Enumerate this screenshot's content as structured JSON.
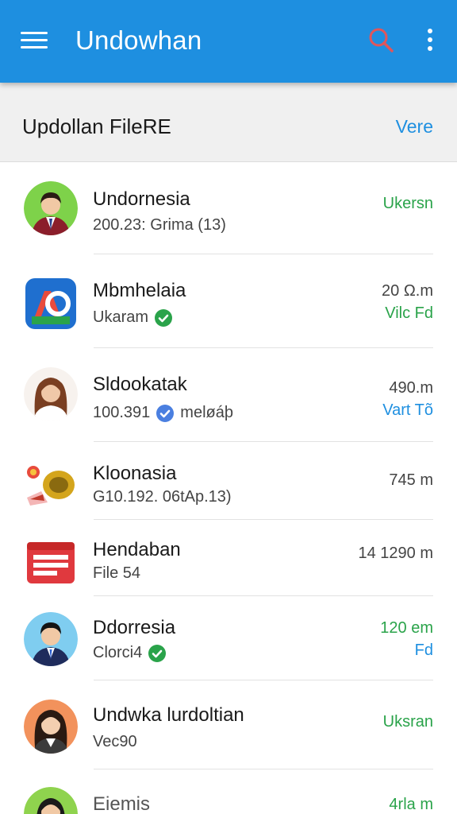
{
  "app": {
    "title": "Undowhan"
  },
  "header": {
    "title": "Updollan FileRE",
    "action": "Vere"
  },
  "items": [
    {
      "title": "Undornesia",
      "subtitle": "200.23:  Grima (13)",
      "meta": [
        "Ukersn"
      ],
      "meta_colors": [
        "green"
      ],
      "verified": false
    },
    {
      "title": "Mbmhelaia",
      "subtitle": "Ukaram",
      "meta": [
        "20 Ω.m",
        "Vilc Fd"
      ],
      "meta_colors": [
        "gray",
        "green"
      ],
      "verified": true
    },
    {
      "title": "Sldookatak",
      "subtitle": "100.391",
      "subtitle_after": "meløáþ",
      "meta": [
        "490.m",
        "Vart Tõ"
      ],
      "meta_colors": [
        "gray",
        "blue"
      ],
      "verified": true
    },
    {
      "title": "Kloonasia",
      "subtitle": "G10.192.  06tAp.13)",
      "meta": [
        "745 m"
      ],
      "meta_colors": [
        "gray"
      ],
      "verified": false
    },
    {
      "title": "Hendaban",
      "subtitle": "File 54",
      "meta": [
        "14 1290 m"
      ],
      "meta_colors": [
        "gray"
      ],
      "verified": false
    },
    {
      "title": "Ddorresia",
      "subtitle": "Clorci4",
      "meta": [
        "120 em",
        "Fd"
      ],
      "meta_colors": [
        "green",
        "blue"
      ],
      "verified": true
    },
    {
      "title": "Undwka lurdoltian",
      "subtitle": "Vec90",
      "meta": [
        "Uksran"
      ],
      "meta_colors": [
        "green"
      ],
      "verified": false
    },
    {
      "title": "Eiemis",
      "subtitle": "",
      "meta": [
        "4rla m"
      ],
      "meta_colors": [
        "green"
      ],
      "verified": false
    }
  ],
  "icons": {
    "menu": "hamburger-icon",
    "search": "search-icon",
    "more": "more-vert-icon",
    "verified": "check-circle-icon"
  },
  "colors": {
    "primary": "#1e8fe0",
    "green": "#2aa34a",
    "search_icon": "#e0565b"
  }
}
